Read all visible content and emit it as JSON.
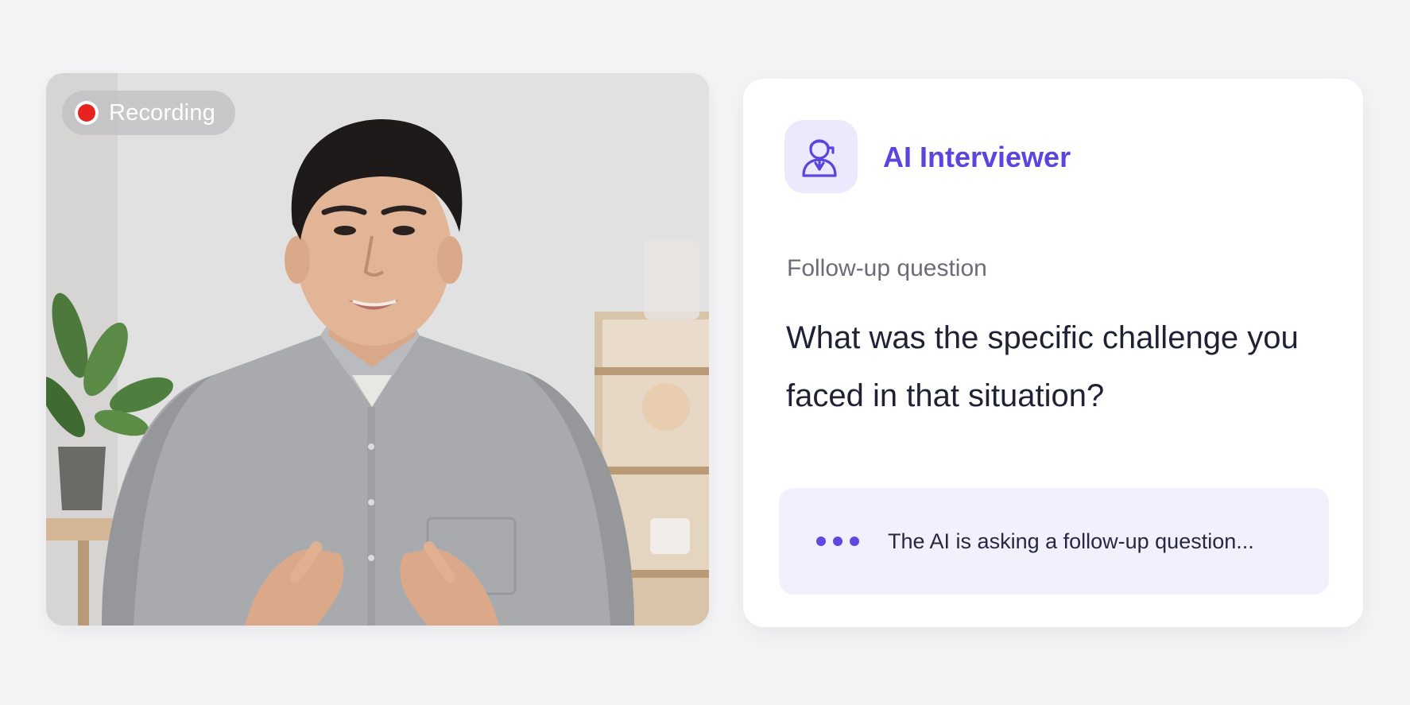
{
  "video": {
    "recording_label": "Recording",
    "status_color": "#e8231f"
  },
  "interviewer": {
    "title": "AI Interviewer",
    "icon": "ai-interviewer-avatar-icon",
    "accent_color": "#5b45e0"
  },
  "question": {
    "eyebrow": "Follow-up question",
    "text": "What was the specific challenge you faced in that situation?"
  },
  "status": {
    "icon": "typing-dots-icon",
    "text": "The AI is asking a follow-up question..."
  }
}
